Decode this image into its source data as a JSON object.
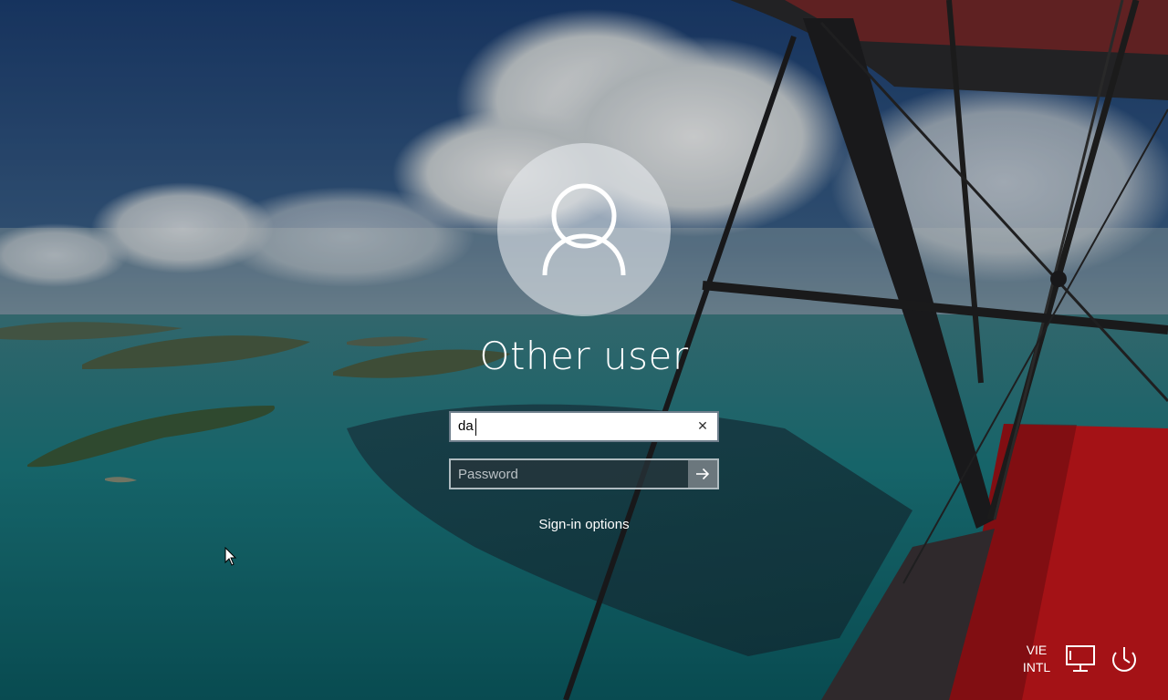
{
  "login": {
    "display_name": "Other user",
    "username_value": "da",
    "password_placeholder": "Password",
    "signin_options_label": "Sign-in options",
    "clear_glyph": "✕"
  },
  "tray": {
    "language_line1": "VIE",
    "language_line2": "INTL",
    "network_icon": "network-icon",
    "power_icon": "power-icon"
  },
  "icons": {
    "avatar": "user-silhouette-icon",
    "submit": "arrow-right-icon",
    "clear": "close-icon"
  },
  "colors": {
    "text": "#ffffff",
    "field_border": "#6f7f8c",
    "plane_red": "#c8161c"
  }
}
